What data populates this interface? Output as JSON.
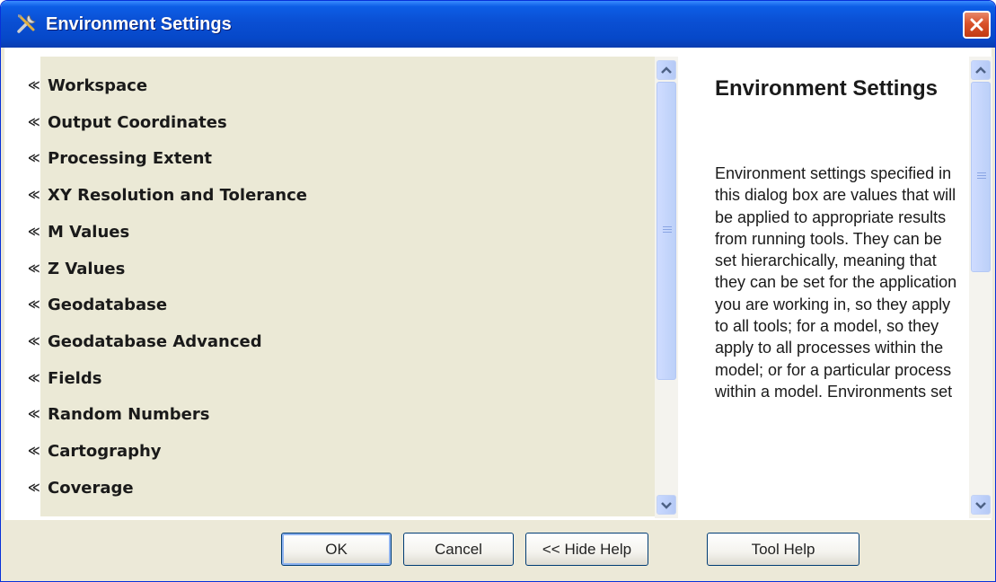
{
  "window": {
    "title": "Environment Settings",
    "title_icon": "tools-icon",
    "close_icon": "close-icon"
  },
  "settings": {
    "items": [
      {
        "label": "Workspace"
      },
      {
        "label": "Output Coordinates"
      },
      {
        "label": "Processing Extent"
      },
      {
        "label": "XY Resolution and Tolerance"
      },
      {
        "label": "M Values"
      },
      {
        "label": "Z Values"
      },
      {
        "label": "Geodatabase"
      },
      {
        "label": "Geodatabase Advanced"
      },
      {
        "label": "Fields"
      },
      {
        "label": "Random Numbers"
      },
      {
        "label": "Cartography"
      },
      {
        "label": "Coverage"
      }
    ],
    "expand_icon": "double-chevron-down-icon"
  },
  "help": {
    "title": "Environment Settings",
    "body": "Environment settings specified in this dialog box are values that will be applied to appropriate results from running tools. They can be set hierarchically, meaning that they can be set for the application you are working in, so they apply to all tools; for a model, so they apply to all processes within the model; or for a particular process within a model. Environments set"
  },
  "buttons": {
    "ok": "OK",
    "cancel": "Cancel",
    "hide_help": "<< Hide Help",
    "tool_help": "Tool Help"
  },
  "colors": {
    "title_bar": "#0a4fd3",
    "dialog_bg": "#ece9d8",
    "scrollbar_thumb": "#bcd0f8"
  }
}
